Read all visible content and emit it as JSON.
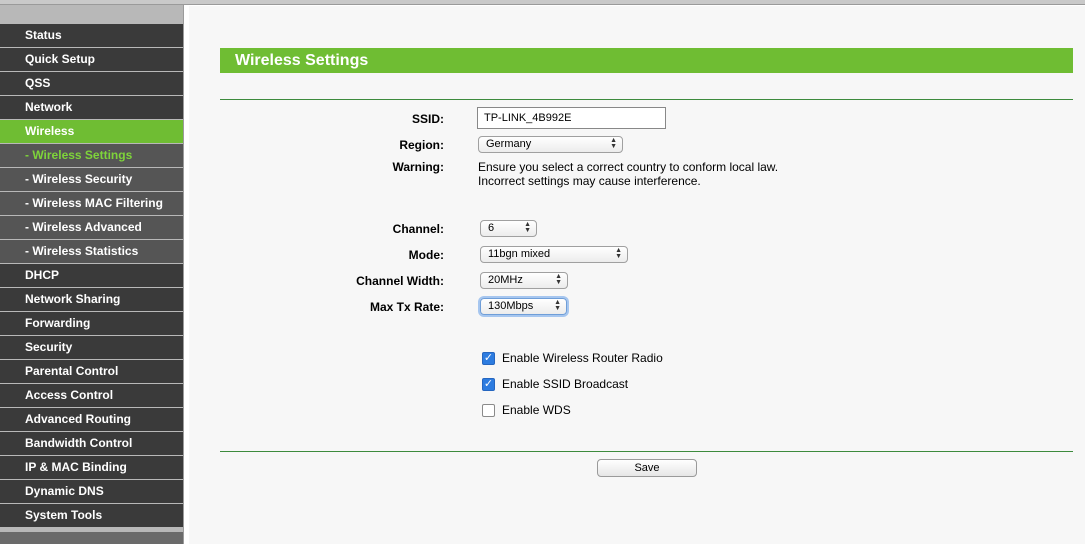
{
  "sidebar": {
    "items": [
      {
        "label": "Status"
      },
      {
        "label": "Quick Setup"
      },
      {
        "label": "QSS"
      },
      {
        "label": "Network"
      },
      {
        "label": "Wireless"
      },
      {
        "label": "- Wireless Settings"
      },
      {
        "label": "- Wireless Security"
      },
      {
        "label": "- Wireless MAC Filtering"
      },
      {
        "label": "- Wireless Advanced"
      },
      {
        "label": "- Wireless Statistics"
      },
      {
        "label": "DHCP"
      },
      {
        "label": "Network Sharing"
      },
      {
        "label": "Forwarding"
      },
      {
        "label": "Security"
      },
      {
        "label": "Parental Control"
      },
      {
        "label": "Access Control"
      },
      {
        "label": "Advanced Routing"
      },
      {
        "label": "Bandwidth Control"
      },
      {
        "label": "IP & MAC Binding"
      },
      {
        "label": "Dynamic DNS"
      },
      {
        "label": "System Tools"
      }
    ],
    "active_item": "Wireless",
    "active_subitem": "- Wireless Settings"
  },
  "main": {
    "title": "Wireless Settings",
    "ssid": {
      "label": "SSID:",
      "value": "TP-LINK_4B992E"
    },
    "region": {
      "label": "Region:",
      "value": "Germany"
    },
    "warning": {
      "label": "Warning:",
      "line1": "Ensure you select a correct country to conform local law.",
      "line2": "Incorrect settings may cause interference."
    },
    "channel": {
      "label": "Channel:",
      "value": "6"
    },
    "mode": {
      "label": "Mode:",
      "value": "11bgn mixed"
    },
    "channel_width": {
      "label": "Channel Width:",
      "value": "20MHz"
    },
    "max_tx_rate": {
      "label": "Max Tx Rate:",
      "value": "130Mbps"
    },
    "options": {
      "enable_radio": {
        "label": "Enable Wireless Router Radio",
        "checked": true
      },
      "enable_ssid_broadcast": {
        "label": "Enable SSID Broadcast",
        "checked": true
      },
      "enable_wds": {
        "label": "Enable WDS",
        "checked": false
      }
    },
    "save_label": "Save"
  },
  "colors": {
    "accent_green": "#6fbd33",
    "menu_dark": "#3a3a3a",
    "menu_sub": "#555555",
    "rule_green": "#3d8b3d"
  },
  "icons": {
    "select_arrow": "updown-chevron-icon",
    "checkmark": "checkmark-icon"
  }
}
